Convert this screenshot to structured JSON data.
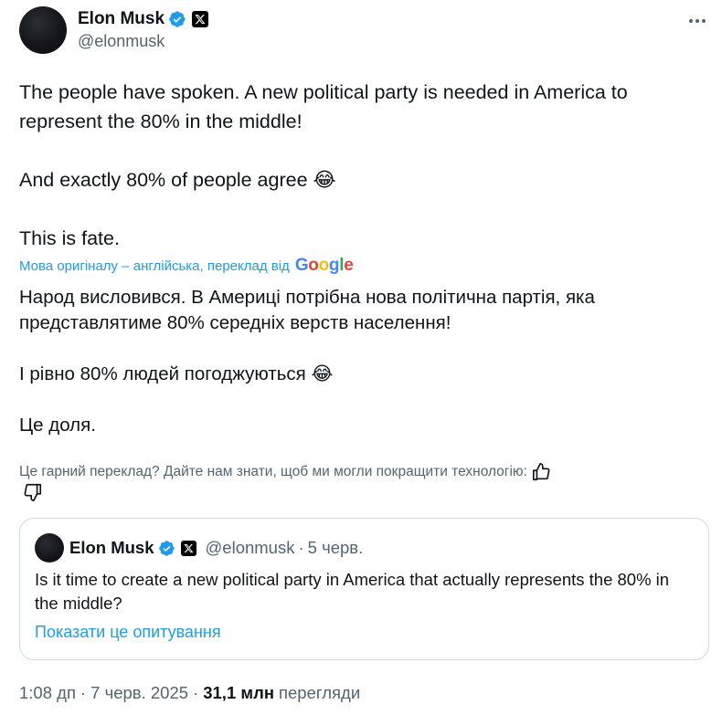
{
  "author": {
    "name": "Elon Musk",
    "handle": "@elonmusk",
    "avatar_icon": "avatar-icon",
    "verified_icon": "verified-badge-icon",
    "affiliate_icon": "x-logo-icon"
  },
  "tweet": {
    "text": "The people have spoken. A new political party is needed in America to\nrepresent the 80% in the middle!\n\nAnd exactly 80% of people agree 😂\n\nThis is fate."
  },
  "translation": {
    "label": "Мова оригіналу – англійська, переклад від",
    "provider": "Google",
    "text": "Народ висловився. В Америці потрібна нова політична партія, яка\nпредставлятиме 80% середніх верств населення!\n\nІ рівно 80% людей погоджуються 😂\n\nЦе доля.",
    "feedback_prompt": "Це гарний переклад? Дайте нам знати, щоб ми могли покращити технологію:"
  },
  "quoted_tweet": {
    "name": "Elon Musk",
    "handle": "@elonmusk",
    "separator": "·",
    "date": "5 черв.",
    "text": "Is it time to create a new political party in America that actually represents the 80% in the middle?",
    "poll_link": "Показати це опитування"
  },
  "meta": {
    "time": "1:08 дп",
    "sep1": "·",
    "date": "7 черв. 2025",
    "sep2": "·",
    "views_count": "31,1 млн",
    "views_label": "перегляди"
  },
  "colors": {
    "accent": "#1d9bf0",
    "secondary_text": "#536471",
    "primary_text": "#0f1419",
    "border": "#cfd9de"
  }
}
